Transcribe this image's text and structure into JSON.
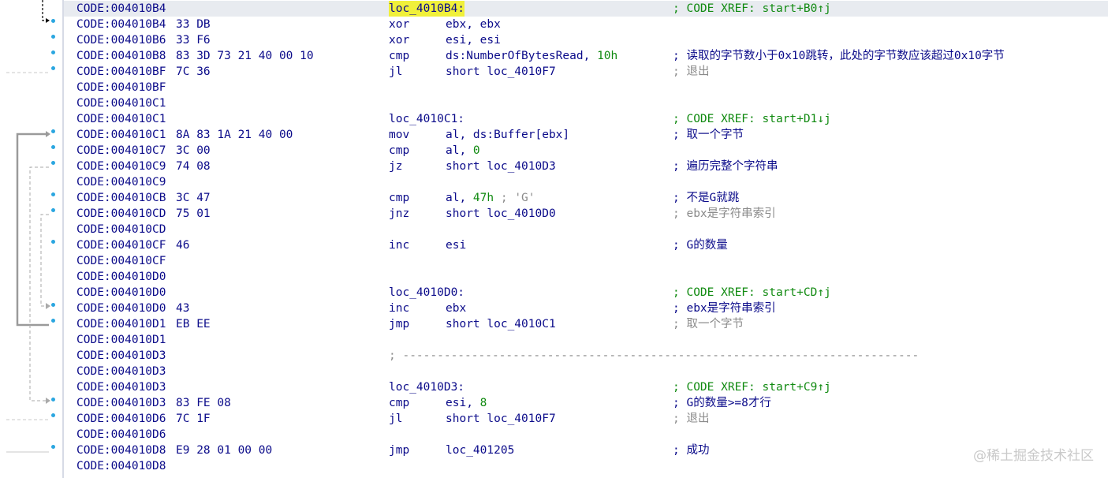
{
  "rows": [
    {
      "addr": "CODE:004010B4",
      "bytes": "",
      "mnem": "",
      "ops": "",
      "label": "loc_4010B4:",
      "cmt": "; CODE XREF: start+B0↑j",
      "cmt_style": "xref",
      "selected": true,
      "highlight": true
    },
    {
      "addr": "CODE:004010B4",
      "bytes": "33 DB",
      "mnem": "xor",
      "ops": "ebx, ebx",
      "cmt": ""
    },
    {
      "addr": "CODE:004010B6",
      "bytes": "33 F6",
      "mnem": "xor",
      "ops": "esi, esi",
      "cmt": ""
    },
    {
      "addr": "CODE:004010B8",
      "bytes": "83 3D 73 21 40 00 10",
      "mnem": "cmp",
      "ops": "ds:NumberOfBytesRead, ",
      "num": "10h",
      "cmt": "; 读取的字节数小于0x10跳转，此处的字节数应该超过0x10字节",
      "cmt_style": "normal"
    },
    {
      "addr": "CODE:004010BF",
      "bytes": "7C 36",
      "mnem": "jl",
      "ops": "short loc_4010F7",
      "cmt": "; 退出",
      "cmt_style": "grey"
    },
    {
      "addr": "CODE:004010BF",
      "bytes": "",
      "mnem": "",
      "ops": "",
      "cmt": ""
    },
    {
      "addr": "CODE:004010C1",
      "bytes": "",
      "mnem": "",
      "ops": "",
      "cmt": ""
    },
    {
      "addr": "CODE:004010C1",
      "bytes": "",
      "mnem": "",
      "ops": "",
      "label": "loc_4010C1:",
      "cmt": "; CODE XREF: start+D1↓j",
      "cmt_style": "xref"
    },
    {
      "addr": "CODE:004010C1",
      "bytes": "8A 83 1A 21 40 00",
      "mnem": "mov",
      "ops": "al, ds:Buffer[ebx]",
      "cmt": "; 取一个字节",
      "cmt_style": "normal"
    },
    {
      "addr": "CODE:004010C7",
      "bytes": "3C 00",
      "mnem": "cmp",
      "ops": "al, ",
      "num": "0",
      "cmt": ""
    },
    {
      "addr": "CODE:004010C9",
      "bytes": "74 08",
      "mnem": "jz",
      "ops": "short loc_4010D3",
      "cmt": "; 遍历完整个字符串",
      "cmt_style": "normal"
    },
    {
      "addr": "CODE:004010C9",
      "bytes": "",
      "mnem": "",
      "ops": "",
      "cmt": ""
    },
    {
      "addr": "CODE:004010CB",
      "bytes": "3C 47",
      "mnem": "cmp",
      "ops": "al, ",
      "num": "47h",
      "inline": " ; 'G'",
      "cmt": "; 不是G就跳",
      "cmt_style": "normal"
    },
    {
      "addr": "CODE:004010CD",
      "bytes": "75 01",
      "mnem": "jnz",
      "ops": "short loc_4010D0",
      "cmt": "; ebx是字符串索引",
      "cmt_style": "grey"
    },
    {
      "addr": "CODE:004010CD",
      "bytes": "",
      "mnem": "",
      "ops": "",
      "cmt": ""
    },
    {
      "addr": "CODE:004010CF",
      "bytes": "46",
      "mnem": "inc",
      "ops": "esi",
      "cmt": "; G的数量",
      "cmt_style": "normal"
    },
    {
      "addr": "CODE:004010CF",
      "bytes": "",
      "mnem": "",
      "ops": "",
      "cmt": ""
    },
    {
      "addr": "CODE:004010D0",
      "bytes": "",
      "mnem": "",
      "ops": "",
      "cmt": ""
    },
    {
      "addr": "CODE:004010D0",
      "bytes": "",
      "mnem": "",
      "ops": "",
      "label": "loc_4010D0:",
      "cmt": "; CODE XREF: start+CD↑j",
      "cmt_style": "xref"
    },
    {
      "addr": "CODE:004010D0",
      "bytes": "43",
      "mnem": "inc",
      "ops": "ebx",
      "cmt": "; ebx是字符串索引",
      "cmt_style": "normal"
    },
    {
      "addr": "CODE:004010D1",
      "bytes": "EB EE",
      "mnem": "jmp",
      "ops": "short loc_4010C1",
      "cmt": "; 取一个字节",
      "cmt_style": "grey"
    },
    {
      "addr": "CODE:004010D1",
      "bytes": "",
      "mnem": "",
      "ops": "",
      "cmt": ""
    },
    {
      "addr": "CODE:004010D3",
      "bytes": "",
      "mnem": "",
      "ops": "",
      "sep": "; ---------------------------------------------------------------------------",
      "cmt": ""
    },
    {
      "addr": "CODE:004010D3",
      "bytes": "",
      "mnem": "",
      "ops": "",
      "cmt": ""
    },
    {
      "addr": "CODE:004010D3",
      "bytes": "",
      "mnem": "",
      "ops": "",
      "label": "loc_4010D3:",
      "cmt": "; CODE XREF: start+C9↑j",
      "cmt_style": "xref"
    },
    {
      "addr": "CODE:004010D3",
      "bytes": "83 FE 08",
      "mnem": "cmp",
      "ops": "esi, ",
      "num": "8",
      "cmt": "; G的数量>=8才行",
      "cmt_style": "normal"
    },
    {
      "addr": "CODE:004010D6",
      "bytes": "7C 1F",
      "mnem": "jl",
      "ops": "short loc_4010F7",
      "cmt": "; 退出",
      "cmt_style": "grey"
    },
    {
      "addr": "CODE:004010D6",
      "bytes": "",
      "mnem": "",
      "ops": "",
      "cmt": ""
    },
    {
      "addr": "CODE:004010D8",
      "bytes": "E9 28 01 00 00",
      "mnem": "jmp",
      "ops": "loc_401205",
      "cmt": "; 成功",
      "cmt_style": "normal"
    },
    {
      "addr": "CODE:004010D8",
      "bytes": "",
      "mnem": "",
      "ops": "",
      "cmt": ""
    }
  ],
  "watermark": "@稀土掘金技术社区",
  "colors": {
    "address": "#0b0b8a",
    "xref": "#108a10",
    "grey": "#8a8a8a",
    "highlight": "#f0f03a",
    "selected_row": "#e8ebf0",
    "dots": "#2aa6e0"
  }
}
